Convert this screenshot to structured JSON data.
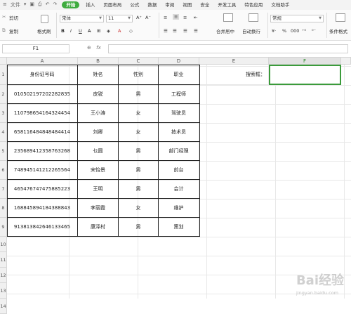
{
  "ribbon": {
    "file_menu": "文件",
    "tabs": [
      "开始",
      "插入",
      "页面布局",
      "公式",
      "数据",
      "审阅",
      "视图",
      "安全",
      "开发工具",
      "特色应用",
      "文档助手"
    ],
    "active_tab": "开始"
  },
  "toolbar": {
    "cut": "剪切",
    "copy": "复制",
    "format_painter": "格式刷",
    "paste": "粘贴",
    "font_name": "宋体",
    "font_size": "11",
    "merge_center": "合并居中",
    "wrap_text": "自动换行",
    "number_format": "常规",
    "conditional_format": "条件格式"
  },
  "formula_bar": {
    "name_box": "F1",
    "fx_label": "fx",
    "zoom_icon": "zoom-icon",
    "formula_value": ""
  },
  "sheet": {
    "columns": [
      "A",
      "B",
      "C",
      "D",
      "E",
      "F"
    ],
    "selected_column": "F",
    "rows": [
      "1",
      "2",
      "3",
      "4",
      "5",
      "6",
      "7",
      "8",
      "9",
      "10",
      "11",
      "12",
      "13",
      "14"
    ],
    "headers": [
      "身份证号码",
      "姓名",
      "性别",
      "职业"
    ],
    "data": [
      [
        "010502197202282835",
        "皮锐",
        "男",
        "工程师"
      ],
      [
        "110798654164324454",
        "王小涛",
        "女",
        "驾驶员"
      ],
      [
        "658116484848484414",
        "刘卿",
        "女",
        "技术员"
      ],
      [
        "235689412358763268",
        "乜圆",
        "男",
        "部门经理"
      ],
      [
        "748945141212265564",
        "宋怡景",
        "男",
        "前台"
      ],
      [
        "465476747475885223",
        "王明",
        "男",
        "会计"
      ],
      [
        "168845894184388843",
        "李丽霞",
        "女",
        "维护"
      ],
      [
        "913813842646133465",
        "康泽村",
        "男",
        "策划"
      ]
    ],
    "search_label": "搜索框：",
    "selected_cell": "F1"
  },
  "watermark": {
    "text": "Bai经验",
    "url": "jingyan.baidu.com"
  }
}
